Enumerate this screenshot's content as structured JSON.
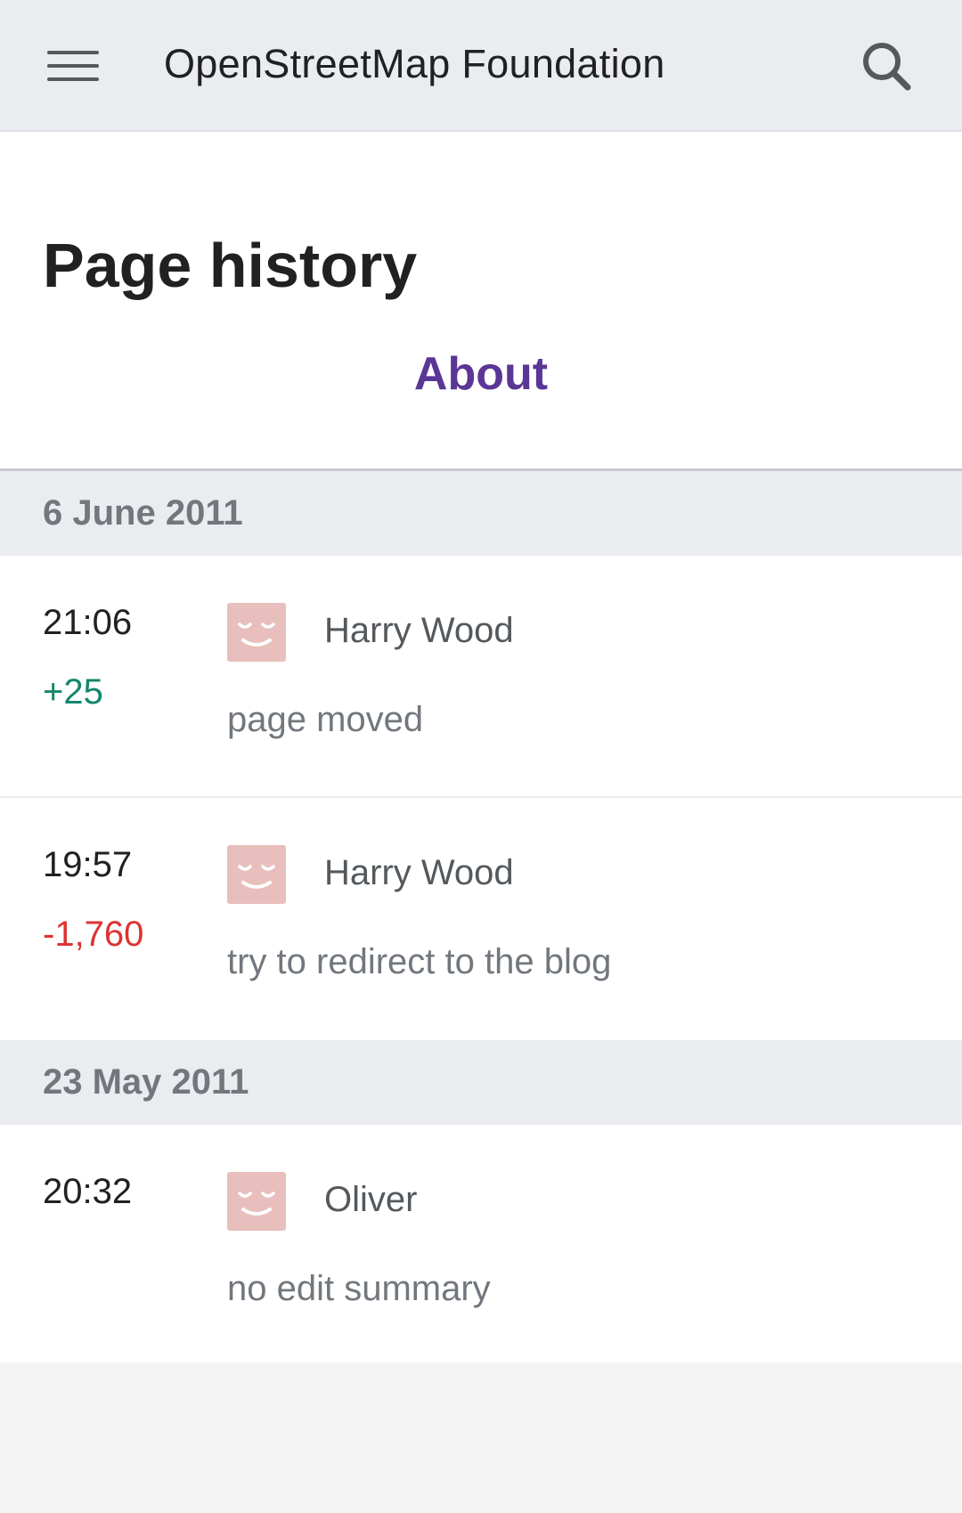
{
  "header": {
    "site_title": "OpenStreetMap Foundation",
    "menu_icon": "hamburger-menu-icon",
    "search_icon": "search-icon"
  },
  "page": {
    "title": "Page history",
    "subject_link": "About"
  },
  "colors": {
    "link": "#5a3696",
    "positive_diff": "#14866d",
    "negative_diff": "#dd3333",
    "avatar_bg": "#e8bfbc"
  },
  "history": {
    "groups": [
      {
        "date": "6 June 2011",
        "entries": [
          {
            "time": "21:06",
            "diff": "+25",
            "user": "Harry Wood",
            "summary": "page moved"
          },
          {
            "time": "19:57",
            "diff": "-1,760",
            "user": "Harry Wood",
            "summary": "try to redirect to the blog"
          }
        ]
      },
      {
        "date": "23 May 2011",
        "entries": [
          {
            "time": "20:32",
            "diff": "",
            "user": "Oliver",
            "summary": "no edit summary"
          }
        ]
      }
    ]
  }
}
